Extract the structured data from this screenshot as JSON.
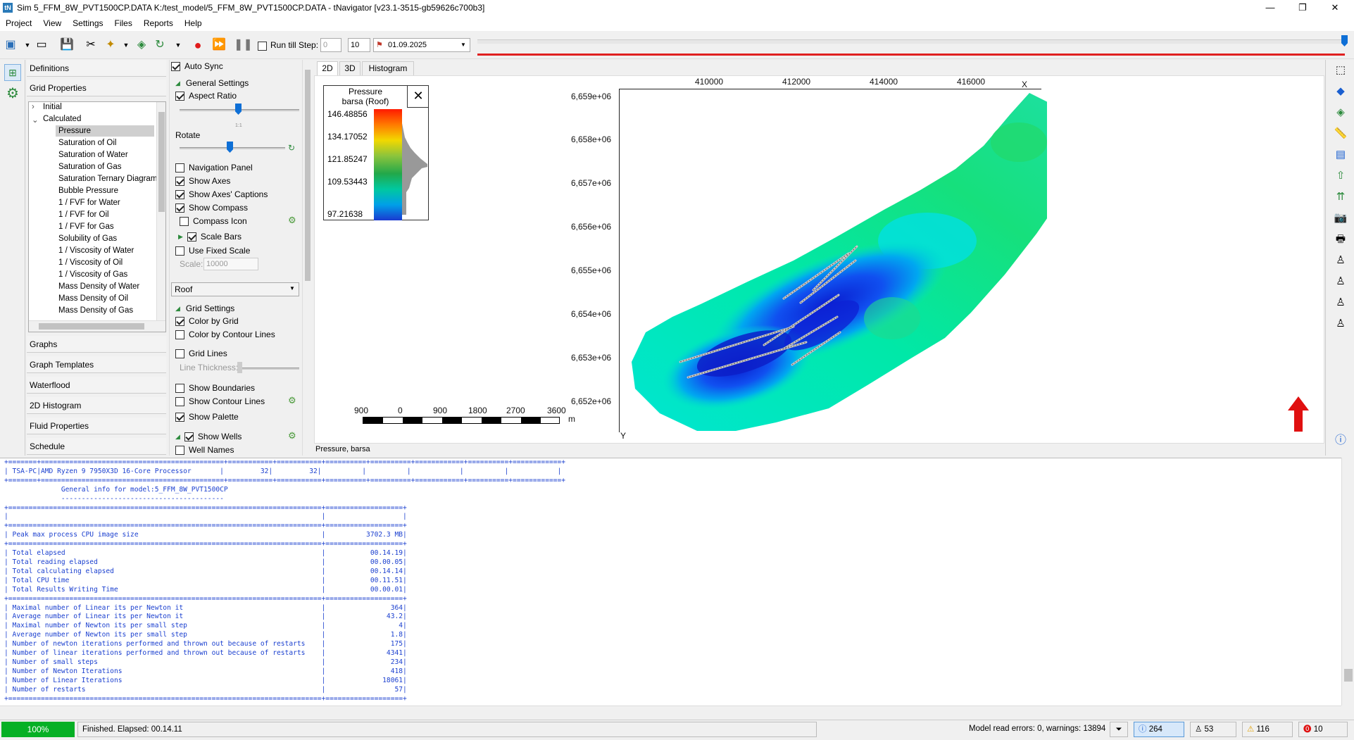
{
  "window": {
    "title": "Sim 5_FFM_8W_PVT1500CP.DATA K:/test_model/5_FFM_8W_PVT1500CP.DATA - tNavigator [v23.1-3515-gb59626c700b3]",
    "logo": "tN",
    "minimize": "—",
    "maximize": "❐",
    "close": "✕"
  },
  "menu": [
    "Project",
    "View",
    "Settings",
    "Files",
    "Reports",
    "Help"
  ],
  "toolbar": {
    "run_till_step_label": "Run till Step:",
    "run_till_step_value": "0",
    "step_value": "10",
    "date": "01.09.2025"
  },
  "left_panel": {
    "sections_top": [
      "Definitions",
      "Grid Properties"
    ],
    "tree": {
      "groups": [
        "Initial",
        "Calculated"
      ],
      "items": [
        "Pressure",
        "Saturation of Oil",
        "Saturation of Water",
        "Saturation of Gas",
        "Saturation Ternary Diagram",
        "Bubble Pressure",
        "1 / FVF for Water",
        "1 / FVF for Oil",
        "1 / FVF for Gas",
        "Solubility of Gas",
        "1 / Viscosity of Water",
        "1 / Viscosity of Oil",
        "1 / Viscosity of Gas",
        "Mass Density of Water",
        "Mass Density of Oil",
        "Mass Density of Gas"
      ],
      "selected": "Pressure"
    },
    "sections_bottom": [
      "Graphs",
      "Graph Templates",
      "Waterflood",
      "2D Histogram",
      "Fluid Properties",
      "Schedule"
    ]
  },
  "settings": {
    "auto_sync": "Auto Sync",
    "general_settings": "General Settings",
    "aspect_ratio": "Aspect Ratio",
    "aspect_value": "1:1",
    "rotate": "Rotate",
    "navigation_panel": "Navigation Panel",
    "show_axes": "Show Axes",
    "show_axes_captions": "Show Axes' Captions",
    "show_compass": "Show Compass",
    "compass_icon": "Compass Icon",
    "scale_bars": "Scale Bars",
    "use_fixed_scale": "Use Fixed Scale",
    "scale_label": "Scale:",
    "scale_value": "10000",
    "surface_select": "Roof",
    "grid_settings": "Grid Settings",
    "color_by_grid": "Color by Grid",
    "color_by_contour": "Color by Contour Lines",
    "grid_lines": "Grid Lines",
    "line_thickness": "Line Thickness:",
    "show_boundaries": "Show Boundaries",
    "show_contour_lines": "Show Contour Lines",
    "show_palette": "Show Palette",
    "show_wells": "Show Wells",
    "well_names": "Well Names"
  },
  "view_tabs": [
    "2D",
    "3D",
    "Histogram"
  ],
  "palette": {
    "title_line1": "Pressure",
    "title_line2": "barsa (Roof)",
    "labels": [
      "146.48856",
      "134.17052",
      "121.85247",
      "109.53443",
      "97.21638"
    ]
  },
  "map": {
    "x_ticks": [
      "410000",
      "412000",
      "414000",
      "416000"
    ],
    "x_axis": "X",
    "y_ticks": [
      "6,659e+06",
      "6,658e+06",
      "6,657e+06",
      "6,656e+06",
      "6,655e+06",
      "6,654e+06",
      "6,653e+06",
      "6,652e+06"
    ],
    "y_axis": "Y",
    "scale_ticks": [
      "900",
      "0",
      "900",
      "1800",
      "2700",
      "3600"
    ],
    "scale_unit": "m"
  },
  "view_status": "Pressure, barsa",
  "console_lines": [
    "+=======+=============================================+===========+===========+==========+==========+============+==========+============+",
    "| TSA-PC|AMD Ryzen 9 7950X3D 16-Core Processor       |         32|         32|          |          |            |          |            |",
    "+=======+=============================================+===========+===========+==========+==========+============+==========+============+",
    "              General info for model:5_FFM_8W_PVT1500CP",
    "              ----------------------------------------",
    "+=============================================================================+===================+",
    "|                                                                             |                   |",
    "+=============================================================================+===================+",
    "| Peak max process CPU image size                                             |          3702.3 MB|",
    "+=============================================================================+===================+",
    "| Total elapsed                                                               |           00.14.19|",
    "| Total reading elapsed                                                       |           00.00.05|",
    "| Total calculating elapsed                                                   |           00.14.14|",
    "| Total CPU time                                                              |           00.11.51|",
    "| Total Results Writing Time                                                  |           00.00.01|",
    "+=============================================================================+===================+",
    "| Maximal number of Linear its per Newton it                                  |                364|",
    "| Average number of Linear its per Newton it                                  |               43.2|",
    "| Maximal number of Newton its per small step                                 |                  4|",
    "| Average number of Newton its per small step                                 |                1.8|",
    "| Number of newton iterations performed and thrown out because of restarts    |                175|",
    "| Number of linear iterations performed and thrown out because of restarts    |               4341|",
    "| Number of small steps                                                       |                234|",
    "| Number of Newton Iterations                                                 |                418|",
    "| Number of Linear Iterations                                                 |              18061|",
    "| Number of restarts                                                          |                 57|",
    "+=============================================================================+===================+"
  ],
  "status": {
    "progress": "100%",
    "message": "Finished. Elapsed: 00.14.11",
    "model_read": "Model read errors: 0, warnings: 13894",
    "info_count": "264",
    "wells_count": "53",
    "warnings_count": "116",
    "errors_count": "10"
  },
  "colors": {
    "accent": "#0e6fd6",
    "progress": "#06b025",
    "timeline_red": "#e02020",
    "console_text": "#1a3fcf"
  }
}
